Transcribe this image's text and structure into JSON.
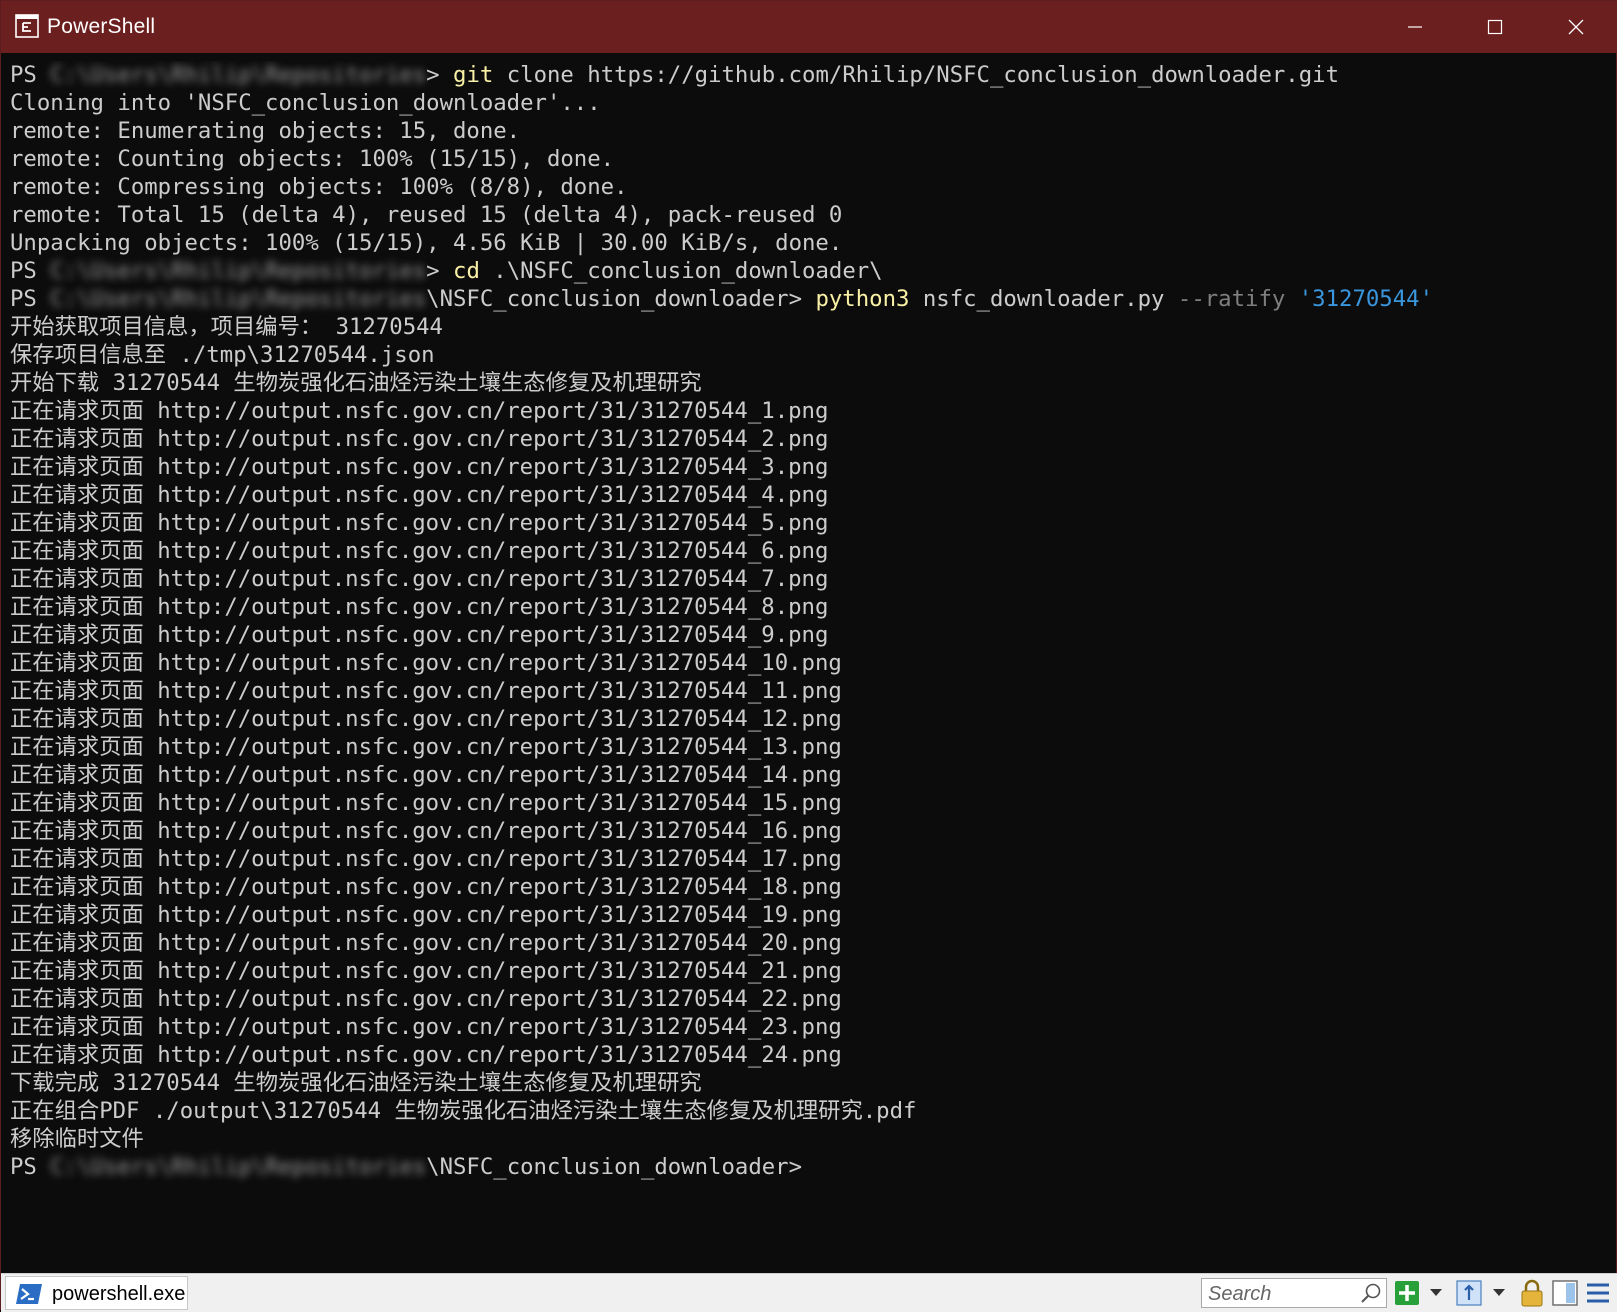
{
  "window": {
    "title": "PowerShell",
    "title_icon": "powershell-window-icon",
    "controls": [
      "minimize-icon",
      "maximize-icon",
      "close-icon"
    ]
  },
  "terminal": {
    "colors": {
      "background": "#0c0c0c",
      "text": "#cccccc",
      "command": "#f9f1a5",
      "parameter": "#7f7f7f",
      "string": "#3a96dd"
    },
    "lines": [
      {
        "prompt": "PS ",
        "redacted": "C:\\Users\\Rhilip\\Repositories",
        "suffix": "> ",
        "cmd": "git",
        "args": " clone https://github.com/Rhilip/NSFC_conclusion_downloader.git"
      },
      {
        "text": "Cloning into 'NSFC_conclusion_downloader'..."
      },
      {
        "text": "remote: Enumerating objects: 15, done."
      },
      {
        "text": "remote: Counting objects: 100% (15/15), done."
      },
      {
        "text": "remote: Compressing objects: 100% (8/8), done."
      },
      {
        "text": "remote: Total 15 (delta 4), reused 15 (delta 4), pack-reused 0"
      },
      {
        "text": "Unpacking objects: 100% (15/15), 4.56 KiB | 30.00 KiB/s, done."
      },
      {
        "prompt": "PS ",
        "redacted": "C:\\Users\\Rhilip\\Repositories",
        "suffix": "> ",
        "cmd": "cd",
        "args": " .\\NSFC_conclusion_downloader\\"
      },
      {
        "prompt": "PS ",
        "redacted": "C:\\Users\\Rhilip\\Repositories",
        "suffix": "\\NSFC_conclusion_downloader> ",
        "cmd": "python3",
        "args": " nsfc_downloader.py ",
        "param": "--ratify",
        "sp": " ",
        "str": "'31270544'"
      },
      {
        "text": "开始获取项目信息，项目编号： 31270544"
      },
      {
        "text": "保存项目信息至 ./tmp\\31270544.json"
      },
      {
        "text": "开始下载 31270544 生物炭强化石油烃污染土壤生态修复及机理研究"
      },
      {
        "text": "正在请求页面 http://output.nsfc.gov.cn/report/31/31270544_1.png"
      },
      {
        "text": "正在请求页面 http://output.nsfc.gov.cn/report/31/31270544_2.png"
      },
      {
        "text": "正在请求页面 http://output.nsfc.gov.cn/report/31/31270544_3.png"
      },
      {
        "text": "正在请求页面 http://output.nsfc.gov.cn/report/31/31270544_4.png"
      },
      {
        "text": "正在请求页面 http://output.nsfc.gov.cn/report/31/31270544_5.png"
      },
      {
        "text": "正在请求页面 http://output.nsfc.gov.cn/report/31/31270544_6.png"
      },
      {
        "text": "正在请求页面 http://output.nsfc.gov.cn/report/31/31270544_7.png"
      },
      {
        "text": "正在请求页面 http://output.nsfc.gov.cn/report/31/31270544_8.png"
      },
      {
        "text": "正在请求页面 http://output.nsfc.gov.cn/report/31/31270544_9.png"
      },
      {
        "text": "正在请求页面 http://output.nsfc.gov.cn/report/31/31270544_10.png"
      },
      {
        "text": "正在请求页面 http://output.nsfc.gov.cn/report/31/31270544_11.png"
      },
      {
        "text": "正在请求页面 http://output.nsfc.gov.cn/report/31/31270544_12.png"
      },
      {
        "text": "正在请求页面 http://output.nsfc.gov.cn/report/31/31270544_13.png"
      },
      {
        "text": "正在请求页面 http://output.nsfc.gov.cn/report/31/31270544_14.png"
      },
      {
        "text": "正在请求页面 http://output.nsfc.gov.cn/report/31/31270544_15.png"
      },
      {
        "text": "正在请求页面 http://output.nsfc.gov.cn/report/31/31270544_16.png"
      },
      {
        "text": "正在请求页面 http://output.nsfc.gov.cn/report/31/31270544_17.png"
      },
      {
        "text": "正在请求页面 http://output.nsfc.gov.cn/report/31/31270544_18.png"
      },
      {
        "text": "正在请求页面 http://output.nsfc.gov.cn/report/31/31270544_19.png"
      },
      {
        "text": "正在请求页面 http://output.nsfc.gov.cn/report/31/31270544_20.png"
      },
      {
        "text": "正在请求页面 http://output.nsfc.gov.cn/report/31/31270544_21.png"
      },
      {
        "text": "正在请求页面 http://output.nsfc.gov.cn/report/31/31270544_22.png"
      },
      {
        "text": "正在请求页面 http://output.nsfc.gov.cn/report/31/31270544_23.png"
      },
      {
        "text": "正在请求页面 http://output.nsfc.gov.cn/report/31/31270544_24.png"
      },
      {
        "text": "下载完成 31270544 生物炭强化石油烃污染土壤生态修复及机理研究"
      },
      {
        "text": "正在组合PDF ./output\\31270544 生物炭强化石油烃污染土壤生态修复及机理研究.pdf"
      },
      {
        "text": "移除临时文件"
      },
      {
        "prompt": "PS ",
        "redacted": "C:\\Users\\Rhilip\\Repositories",
        "suffix": "\\NSFC_conclusion_downloader>"
      }
    ]
  },
  "statusbar": {
    "task_label": "powershell.exe",
    "search_placeholder": "Search",
    "icons": [
      "powershell-icon",
      "search-icon",
      "add-tab-icon",
      "add-dropdown-icon",
      "pane-icon",
      "pane-dropdown-icon",
      "lock-icon",
      "layout-icon",
      "menu-icon"
    ]
  }
}
